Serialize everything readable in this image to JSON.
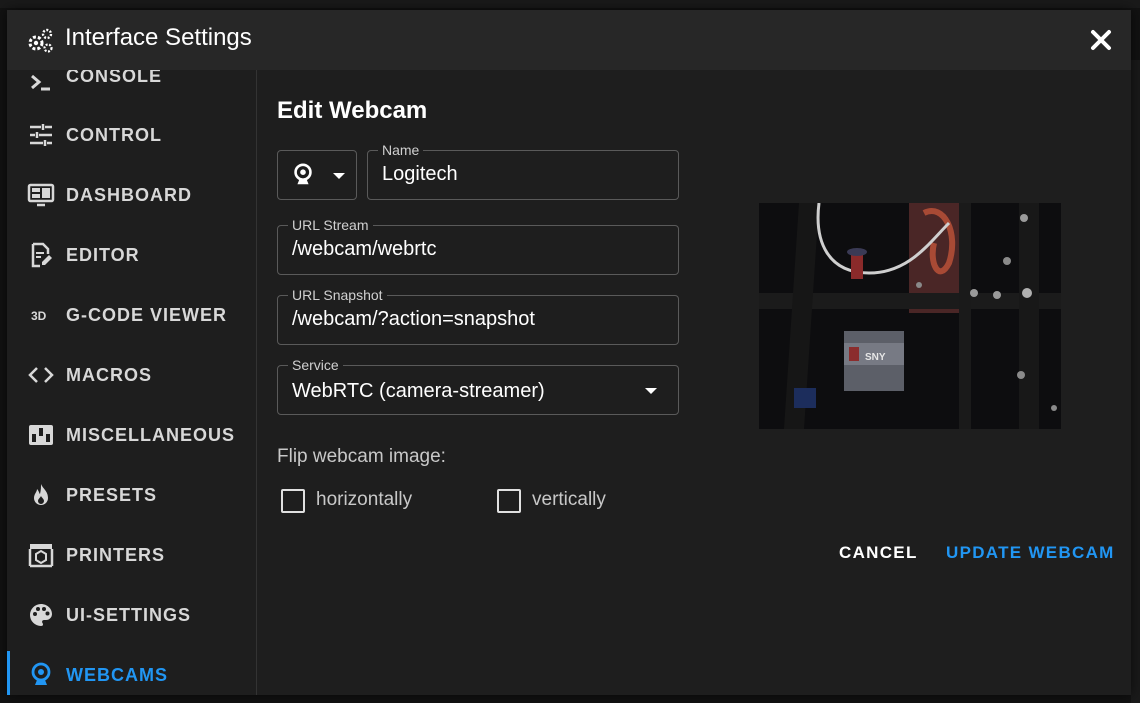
{
  "dialog": {
    "title": "Interface Settings",
    "title_icon": "cogs-icon",
    "close_icon": "close-icon"
  },
  "sidebar": {
    "items": [
      {
        "label": "CONSOLE",
        "icon": "console-icon"
      },
      {
        "label": "CONTROL",
        "icon": "tune-icon"
      },
      {
        "label": "DASHBOARD",
        "icon": "monitor-dashboard-icon"
      },
      {
        "label": "EDITOR",
        "icon": "file-edit-icon"
      },
      {
        "label": "G-CODE VIEWER",
        "icon": "cube-3d-icon"
      },
      {
        "label": "MACROS",
        "icon": "code-tags-icon"
      },
      {
        "label": "MISCELLANEOUS",
        "icon": "dip-switch-icon"
      },
      {
        "label": "PRESETS",
        "icon": "fire-icon"
      },
      {
        "label": "PRINTERS",
        "icon": "printer-3d-icon"
      },
      {
        "label": "UI-SETTINGS",
        "icon": "palette-icon"
      },
      {
        "label": "WEBCAMS",
        "icon": "webcam-icon",
        "active": true
      }
    ]
  },
  "form": {
    "heading": "Edit Webcam",
    "icon_select": {
      "icon": "webcam-icon"
    },
    "name": {
      "label": "Name",
      "value": "Logitech"
    },
    "url_stream": {
      "label": "URL Stream",
      "value": "/webcam/webrtc"
    },
    "url_snapshot": {
      "label": "URL Snapshot",
      "value": "/webcam/?action=snapshot"
    },
    "service": {
      "label": "Service",
      "value": "WebRTC (camera-streamer)"
    },
    "flip_label": "Flip webcam image:",
    "flip_horizontal": {
      "label": "horizontally",
      "checked": false
    },
    "flip_vertical": {
      "label": "vertically",
      "checked": false
    }
  },
  "actions": {
    "cancel": "CANCEL",
    "update": "UPDATE WEBCAM"
  },
  "preview": {
    "overlay_text": "SNY"
  },
  "colors": {
    "accent": "#2196f3",
    "dialog_bg": "#1e1e1e",
    "titlebar_bg": "#272727"
  }
}
